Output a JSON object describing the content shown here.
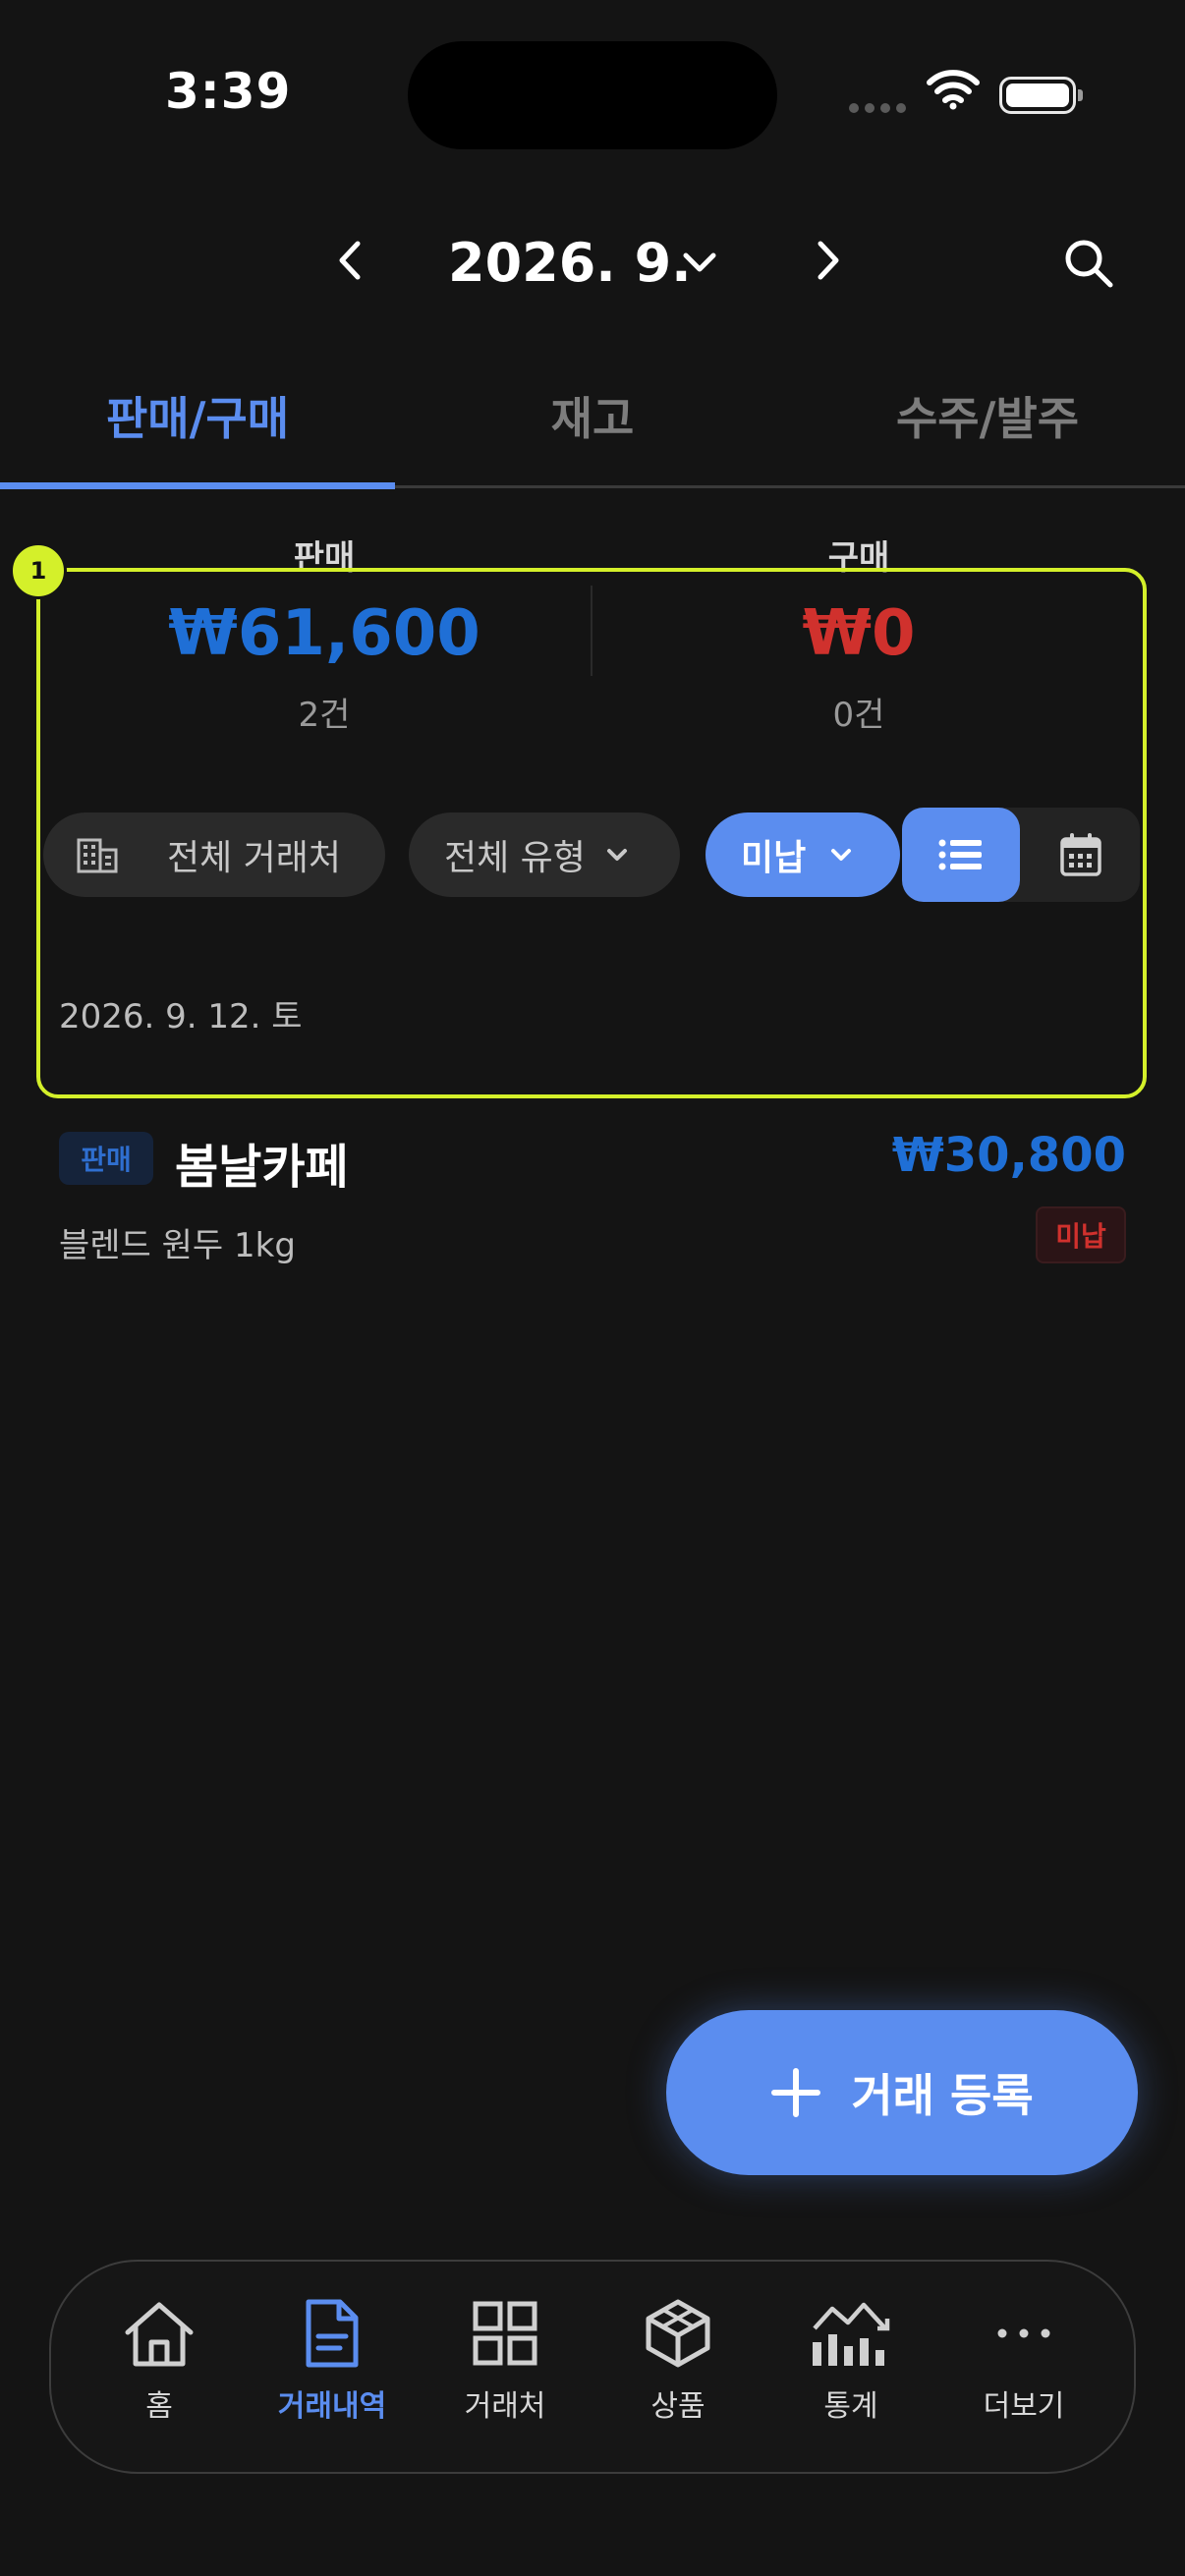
{
  "status_bar": {
    "time": "3:39"
  },
  "header": {
    "month_label": "2026. 9."
  },
  "tabs": [
    {
      "label": "판매/구매",
      "active": true
    },
    {
      "label": "재고",
      "active": false
    },
    {
      "label": "수주/발주",
      "active": false
    }
  ],
  "summary": {
    "sales": {
      "label": "판매",
      "amount": "₩61,600",
      "count": "2건",
      "color": "#1f6fd6"
    },
    "purchase": {
      "label": "구매",
      "amount": "₩0",
      "count": "0건",
      "color": "#d0312d"
    }
  },
  "filters": {
    "partner": "전체 거래처",
    "type": "전체 유형",
    "payment": "미납"
  },
  "highlight": {
    "badge": "1",
    "color": "#d4f02a"
  },
  "list": {
    "date_header": "2026. 9. 12. 토",
    "items": [
      {
        "type": "판매",
        "name": "봄날카페",
        "amount": "₩30,800",
        "description": "블렌드 원두 1kg",
        "status": "미납"
      }
    ]
  },
  "fab": {
    "label": "거래 등록"
  },
  "bottom_nav": [
    {
      "label": "홈",
      "icon": "home-icon",
      "active": false
    },
    {
      "label": "거래내역",
      "icon": "document-icon",
      "active": true
    },
    {
      "label": "거래처",
      "icon": "grid-icon",
      "active": false
    },
    {
      "label": "상품",
      "icon": "box-icon",
      "active": false
    },
    {
      "label": "통계",
      "icon": "chart-icon",
      "active": false
    },
    {
      "label": "더보기",
      "icon": "more-icon",
      "active": false
    }
  ],
  "colors": {
    "accent": "#5b8def",
    "background": "#141414",
    "sales": "#1f6fd6",
    "unpaid": "#d0312d"
  }
}
